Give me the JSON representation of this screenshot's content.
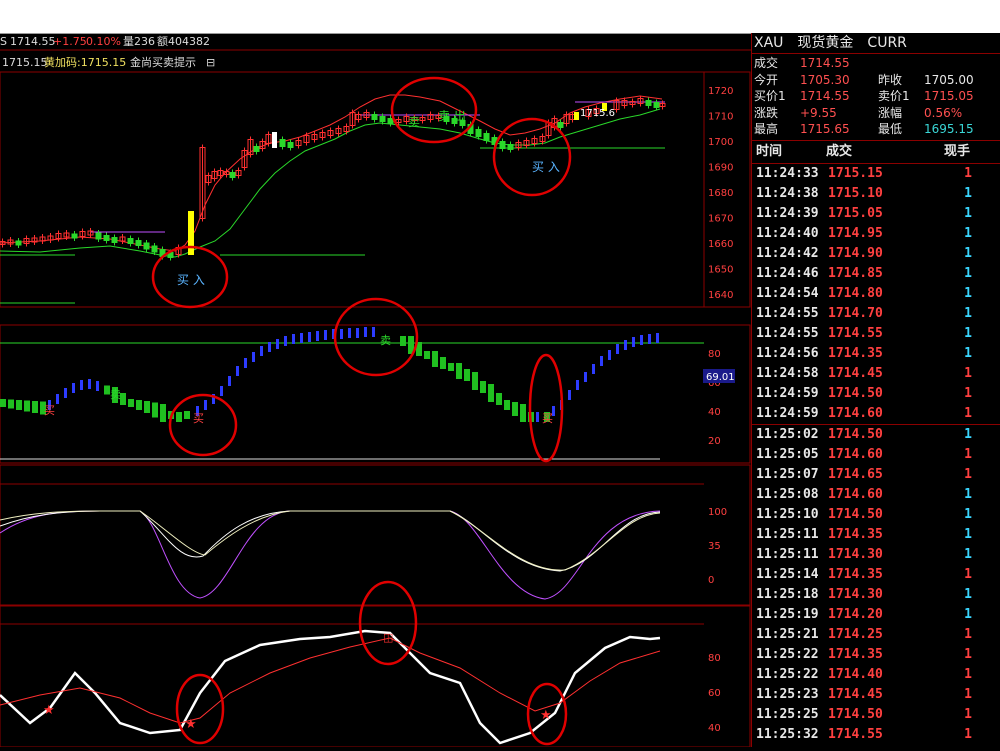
{
  "header": {
    "line1": {
      "price": "1714.55",
      "change": "+1.75",
      "pct": "0.10%",
      "vol": "量236",
      "amt": "额404382"
    },
    "line2": {
      "prefix": "1715.15",
      "code_label": "黄加码:1715.15",
      "hint_label": "金尚买卖提示",
      "toggle": "⊟"
    }
  },
  "main_axis": [
    "1720",
    "1710",
    "1700",
    "1690",
    "1680",
    "1670",
    "1660",
    "1650",
    "1640"
  ],
  "main_annotations": {
    "buy1": "买 入",
    "sell": "卖",
    "sell2": "卖 出",
    "buy2": "买 入",
    "price_tag": "1715.6"
  },
  "p2_axis": [
    "80",
    "60",
    "40",
    "20"
  ],
  "p2_value": "69.01",
  "p2_labels": {
    "buy": "买",
    "sell": "卖"
  },
  "p3_axis": [
    "100",
    "35",
    "0"
  ],
  "p4_axis": [
    "80",
    "60",
    "40"
  ],
  "colors": {
    "up": "#ff3030",
    "down": "#20c020",
    "blue": "#2d3cff",
    "grid": "#8b0000",
    "ma": "#ff3030",
    "ma2": "#2ad82a"
  },
  "quote": {
    "symbol": "XAU",
    "name": "现货黄金",
    "code": "CURR",
    "rows": [
      [
        {
          "l": "成交",
          "v": "1714.55",
          "c": ""
        }
      ],
      [
        {
          "l": "今开",
          "v": "1705.30",
          "c": ""
        },
        {
          "l": "昨收",
          "v": "1705.00",
          "c": "w"
        }
      ],
      [
        {
          "l": "买价1",
          "v": "1714.55",
          "c": ""
        },
        {
          "l": "卖价1",
          "v": "1715.05",
          "c": ""
        }
      ],
      [
        {
          "l": "涨跌",
          "v": "+9.55",
          "c": ""
        },
        {
          "l": "涨幅",
          "v": "0.56%",
          "c": ""
        }
      ],
      [
        {
          "l": "最高",
          "v": "1715.65",
          "c": ""
        },
        {
          "l": "最低",
          "v": "1695.15",
          "c": "g"
        }
      ]
    ]
  },
  "ticks_header": {
    "time": "时间",
    "price": "成交",
    "vol": "现手"
  },
  "ticks": [
    {
      "t": "11:24:33",
      "p": "1715.15",
      "v": "1",
      "d": "up"
    },
    {
      "t": "11:24:38",
      "p": "1715.10",
      "v": "1",
      "d": "dn"
    },
    {
      "t": "11:24:39",
      "p": "1715.05",
      "v": "1",
      "d": "dn"
    },
    {
      "t": "11:24:40",
      "p": "1714.95",
      "v": "1",
      "d": "dn"
    },
    {
      "t": "11:24:42",
      "p": "1714.90",
      "v": "1",
      "d": "dn"
    },
    {
      "t": "11:24:46",
      "p": "1714.85",
      "v": "1",
      "d": "dn"
    },
    {
      "t": "11:24:54",
      "p": "1714.80",
      "v": "1",
      "d": "dn"
    },
    {
      "t": "11:24:55",
      "p": "1714.70",
      "v": "1",
      "d": "dn"
    },
    {
      "t": "11:24:55",
      "p": "1714.55",
      "v": "1",
      "d": "dn"
    },
    {
      "t": "11:24:56",
      "p": "1714.35",
      "v": "1",
      "d": "dn"
    },
    {
      "t": "11:24:58",
      "p": "1714.45",
      "v": "1",
      "d": "up"
    },
    {
      "t": "11:24:59",
      "p": "1714.50",
      "v": "1",
      "d": "up"
    },
    {
      "t": "11:24:59",
      "p": "1714.60",
      "v": "1",
      "d": "up"
    },
    {
      "t": "11:25:02",
      "p": "1714.50",
      "v": "1",
      "d": "dn"
    },
    {
      "t": "11:25:05",
      "p": "1714.60",
      "v": "1",
      "d": "up"
    },
    {
      "t": "11:25:07",
      "p": "1714.65",
      "v": "1",
      "d": "up"
    },
    {
      "t": "11:25:08",
      "p": "1714.60",
      "v": "1",
      "d": "dn"
    },
    {
      "t": "11:25:10",
      "p": "1714.50",
      "v": "1",
      "d": "dn"
    },
    {
      "t": "11:25:11",
      "p": "1714.35",
      "v": "1",
      "d": "dn"
    },
    {
      "t": "11:25:11",
      "p": "1714.30",
      "v": "1",
      "d": "dn"
    },
    {
      "t": "11:25:14",
      "p": "1714.35",
      "v": "1",
      "d": "up"
    },
    {
      "t": "11:25:18",
      "p": "1714.30",
      "v": "1",
      "d": "dn"
    },
    {
      "t": "11:25:19",
      "p": "1714.20",
      "v": "1",
      "d": "dn"
    },
    {
      "t": "11:25:21",
      "p": "1714.25",
      "v": "1",
      "d": "up"
    },
    {
      "t": "11:25:22",
      "p": "1714.35",
      "v": "1",
      "d": "up"
    },
    {
      "t": "11:25:22",
      "p": "1714.40",
      "v": "1",
      "d": "up"
    },
    {
      "t": "11:25:23",
      "p": "1714.45",
      "v": "1",
      "d": "up"
    },
    {
      "t": "11:25:25",
      "p": "1714.50",
      "v": "1",
      "d": "up"
    },
    {
      "t": "11:25:32",
      "p": "1714.55",
      "v": "1",
      "d": "up"
    }
  ]
}
